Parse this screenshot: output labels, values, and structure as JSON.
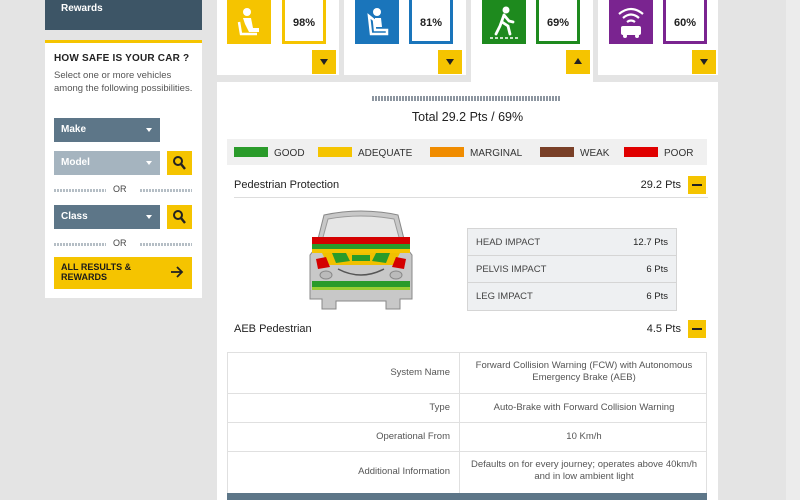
{
  "sidebar": {
    "rewards_label": "Rewards",
    "title": "HOW SAFE IS YOUR CAR ?",
    "description": "Select one or more vehicles among the following possibilities.",
    "make_label": "Make",
    "model_label": "Model",
    "or_label": "OR",
    "class_label": "Class",
    "all_results_label": "ALL RESULTS & REWARDS"
  },
  "tiles": [
    {
      "name": "Adult Occupant",
      "icon": "adult-occupant-icon",
      "percent": "98%",
      "color": "#f5c400",
      "expanded": false
    },
    {
      "name": "Child Occupant",
      "icon": "child-seat-icon",
      "percent": "81%",
      "color": "#1a75bb",
      "expanded": false
    },
    {
      "name": "Vulnerable Road Users",
      "icon": "pedestrian-icon",
      "percent": "69%",
      "color": "#1e8a1e",
      "expanded": true
    },
    {
      "name": "Safety Assist",
      "icon": "safety-assist-icon",
      "percent": "60%",
      "color": "#7a2490",
      "expanded": false
    }
  ],
  "main": {
    "total": "Total 29.2 Pts / 69%",
    "legend": [
      {
        "label": "GOOD",
        "color": "#2a9b2a"
      },
      {
        "label": "ADEQUATE",
        "color": "#f5c400"
      },
      {
        "label": "MARGINAL",
        "color": "#f08c00"
      },
      {
        "label": "WEAK",
        "color": "#7a4028"
      },
      {
        "label": "POOR",
        "color": "#e00000"
      }
    ],
    "pedestrian": {
      "label": "Pedestrian Protection",
      "points": "29.2 Pts",
      "impacts": [
        {
          "label": "HEAD IMPACT",
          "value": "12.7 Pts"
        },
        {
          "label": "PELVIS IMPACT",
          "value": "6 Pts"
        },
        {
          "label": "LEG IMPACT",
          "value": "6 Pts"
        }
      ]
    },
    "aeb": {
      "label": "AEB Pedestrian",
      "points": "4.5 Pts",
      "rows": [
        {
          "key": "System Name",
          "value": "Forward Collision Warning (FCW) with Autonomous Emergency Brake (AEB)"
        },
        {
          "key": "Type",
          "value": "Auto-Brake with Forward Collision Warning"
        },
        {
          "key": "Operational From",
          "value": "10 Km/h"
        },
        {
          "key": "Additional Information",
          "value": "Defaults on for every journey; operates above 40km/h and in low ambient light"
        }
      ]
    }
  }
}
